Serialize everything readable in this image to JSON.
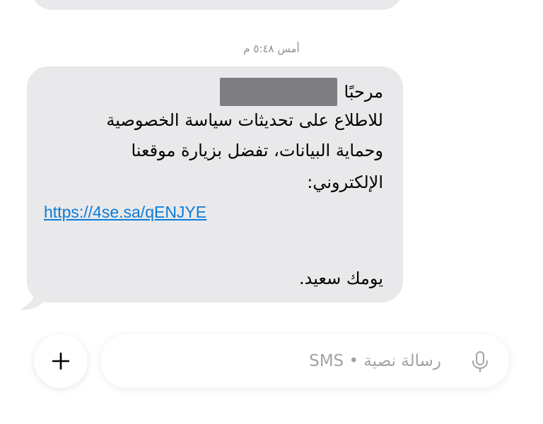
{
  "conversation": {
    "timestamp": "أمس ٥:٤٨ م",
    "message": {
      "line1": "مرحبًا",
      "line2": "للاطلاع على تحديثات سياسة الخصوصية",
      "line3": "وحماية البيانات، تفضل بزيارة موقعنا",
      "line4": "الإلكتروني:",
      "link": "https://4se.sa/qENJYE",
      "line6": "يومك سعيد."
    }
  },
  "composer": {
    "placeholder": "رسالة نصية • SMS",
    "plus_icon": "plus-icon",
    "mic_icon": "microphone-icon"
  },
  "colors": {
    "incoming_bubble": "#e9e9eb",
    "link": "#0b7bd7",
    "timestamp": "#8e8e93",
    "placeholder": "#a3a3a8"
  }
}
